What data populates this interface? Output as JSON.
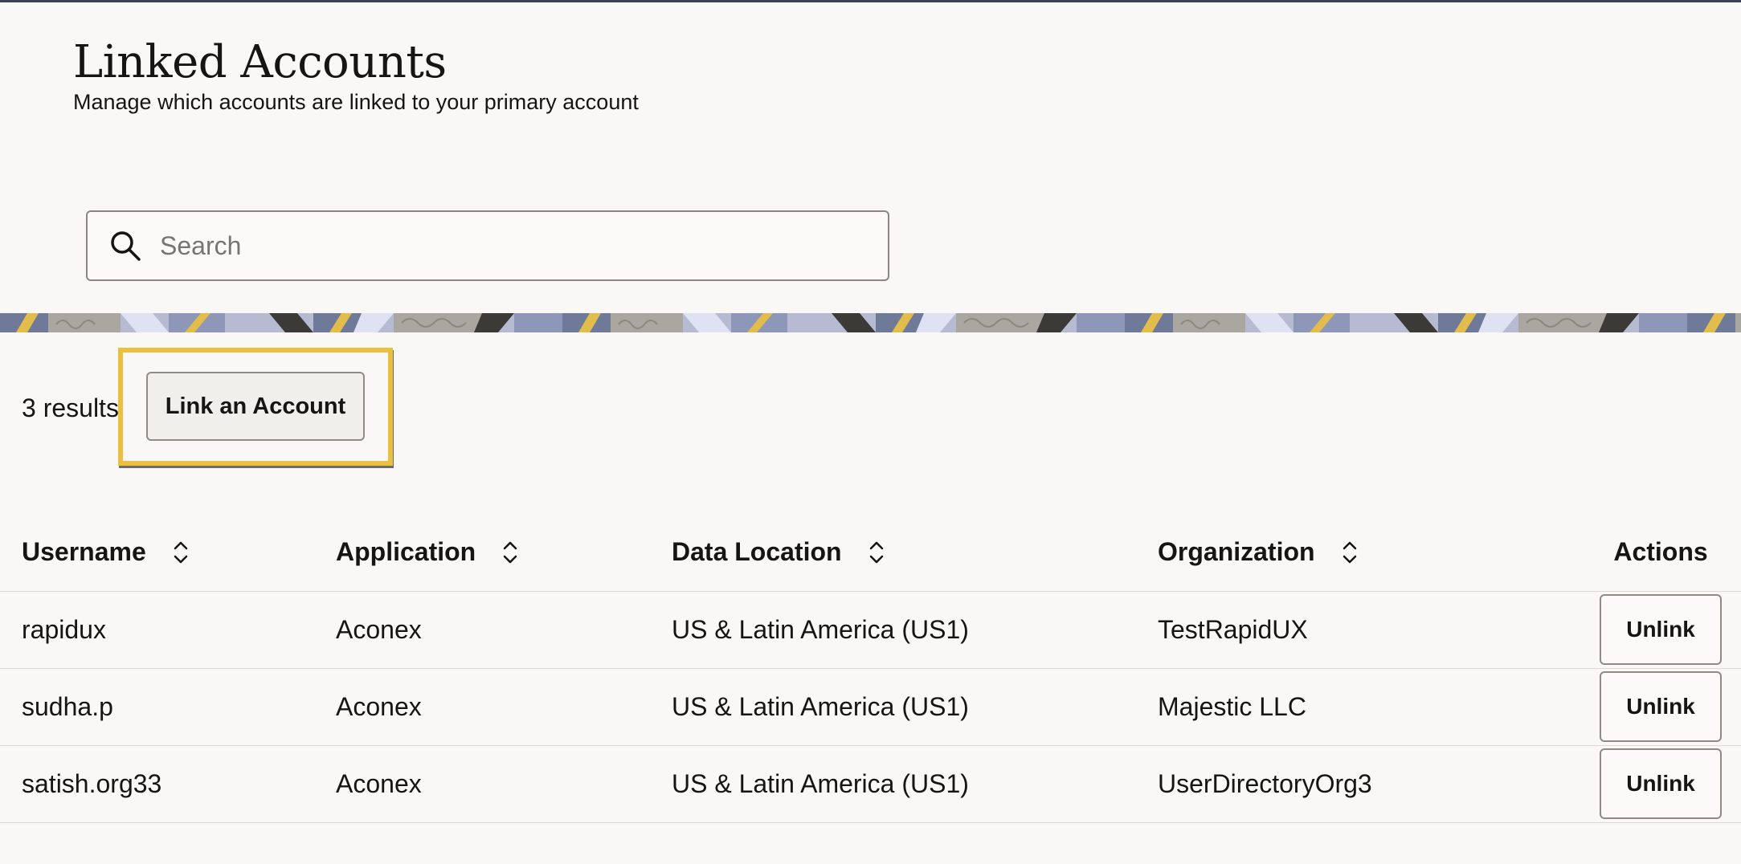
{
  "header": {
    "title": "Linked Accounts",
    "subtitle": "Manage which accounts are linked to your primary account"
  },
  "search": {
    "placeholder": "Search",
    "value": "",
    "icon": "search-icon"
  },
  "toolbar": {
    "results_count": "3 results",
    "link_button_label": "Link an Account"
  },
  "table": {
    "columns": [
      {
        "label": "Username",
        "sortable": true
      },
      {
        "label": "Application",
        "sortable": true
      },
      {
        "label": "Data Location",
        "sortable": true
      },
      {
        "label": "Organization",
        "sortable": true
      },
      {
        "label": "Actions",
        "sortable": false
      }
    ],
    "rows": [
      {
        "username": "rapidux",
        "application": "Aconex",
        "data_location": "US & Latin America (US1)",
        "organization": "TestRapidUX",
        "action_label": "Unlink"
      },
      {
        "username": "sudha.p",
        "application": "Aconex",
        "data_location": "US & Latin America (US1)",
        "organization": "Majestic LLC",
        "action_label": "Unlink"
      },
      {
        "username": "satish.org33",
        "application": "Aconex",
        "data_location": "US & Latin America (US1)",
        "organization": "UserDirectoryOrg3",
        "action_label": "Unlink"
      }
    ]
  },
  "colors": {
    "background": "#f9f8f6",
    "text": "#161513",
    "focus_ring": "#ecbf3c",
    "banner_blue": "#6f7a99",
    "banner_lavender": "#b7bbd2",
    "banner_yellow": "#e3bd4b",
    "banner_dark": "#3b3a37",
    "banner_gray": "#a9a7a0"
  }
}
